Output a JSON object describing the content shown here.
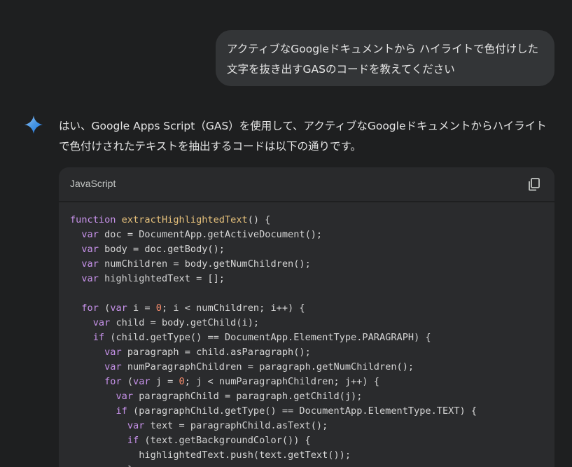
{
  "user_message": {
    "text": "アクティブなGoogleドキュメントから ハイライトで色付けした文字を抜き出すGASのコードを教えてください"
  },
  "assistant": {
    "icon": "gemini-sparkle-icon",
    "response_text": "はい、Google Apps Script（GAS）を使用して、アクティブなGoogleドキュメントからハイライトで色付けされたテキストを抽出するコードは以下の通りです。",
    "code_block": {
      "language": "JavaScript",
      "copy_icon": "copy-icon",
      "lines": [
        [
          {
            "t": "kw",
            "v": "function"
          },
          {
            "t": "",
            "v": " "
          },
          {
            "t": "fn",
            "v": "extractHighlightedText"
          },
          {
            "t": "",
            "v": "() {"
          }
        ],
        [
          {
            "t": "",
            "v": "  "
          },
          {
            "t": "kw",
            "v": "var"
          },
          {
            "t": "",
            "v": " doc = DocumentApp.getActiveDocument();"
          }
        ],
        [
          {
            "t": "",
            "v": "  "
          },
          {
            "t": "kw",
            "v": "var"
          },
          {
            "t": "",
            "v": " body = doc.getBody();"
          }
        ],
        [
          {
            "t": "",
            "v": "  "
          },
          {
            "t": "kw",
            "v": "var"
          },
          {
            "t": "",
            "v": " numChildren = body.getNumChildren();"
          }
        ],
        [
          {
            "t": "",
            "v": "  "
          },
          {
            "t": "kw",
            "v": "var"
          },
          {
            "t": "",
            "v": " highlightedText = [];"
          }
        ],
        [
          {
            "t": "",
            "v": ""
          }
        ],
        [
          {
            "t": "",
            "v": "  "
          },
          {
            "t": "kw",
            "v": "for"
          },
          {
            "t": "",
            "v": " ("
          },
          {
            "t": "kw",
            "v": "var"
          },
          {
            "t": "",
            "v": " i = "
          },
          {
            "t": "num",
            "v": "0"
          },
          {
            "t": "",
            "v": "; i < numChildren; i++) {"
          }
        ],
        [
          {
            "t": "",
            "v": "    "
          },
          {
            "t": "kw",
            "v": "var"
          },
          {
            "t": "",
            "v": " child = body.getChild(i);"
          }
        ],
        [
          {
            "t": "",
            "v": "    "
          },
          {
            "t": "kw",
            "v": "if"
          },
          {
            "t": "",
            "v": " (child.getType() == DocumentApp.ElementType.PARAGRAPH) {"
          }
        ],
        [
          {
            "t": "",
            "v": "      "
          },
          {
            "t": "kw",
            "v": "var"
          },
          {
            "t": "",
            "v": " paragraph = child.asParagraph();"
          }
        ],
        [
          {
            "t": "",
            "v": "      "
          },
          {
            "t": "kw",
            "v": "var"
          },
          {
            "t": "",
            "v": " numParagraphChildren = paragraph.getNumChildren();"
          }
        ],
        [
          {
            "t": "",
            "v": "      "
          },
          {
            "t": "kw",
            "v": "for"
          },
          {
            "t": "",
            "v": " ("
          },
          {
            "t": "kw",
            "v": "var"
          },
          {
            "t": "",
            "v": " j = "
          },
          {
            "t": "num",
            "v": "0"
          },
          {
            "t": "",
            "v": "; j < numParagraphChildren; j++) {"
          }
        ],
        [
          {
            "t": "",
            "v": "        "
          },
          {
            "t": "kw",
            "v": "var"
          },
          {
            "t": "",
            "v": " paragraphChild = paragraph.getChild(j);"
          }
        ],
        [
          {
            "t": "",
            "v": "        "
          },
          {
            "t": "kw",
            "v": "if"
          },
          {
            "t": "",
            "v": " (paragraphChild.getType() == DocumentApp.ElementType.TEXT) {"
          }
        ],
        [
          {
            "t": "",
            "v": "          "
          },
          {
            "t": "kw",
            "v": "var"
          },
          {
            "t": "",
            "v": " text = paragraphChild.asText();"
          }
        ],
        [
          {
            "t": "",
            "v": "          "
          },
          {
            "t": "kw",
            "v": "if"
          },
          {
            "t": "",
            "v": " (text.getBackgroundColor()) {"
          }
        ],
        [
          {
            "t": "",
            "v": "            highlightedText.push(text.getText());"
          }
        ],
        [
          {
            "t": "",
            "v": "          }"
          }
        ]
      ]
    }
  },
  "colors": {
    "background": "#1e1f20",
    "user_bubble": "#333537",
    "code_background": "#2a2b2d",
    "keyword": "#c792ea",
    "function_name": "#e5c07b",
    "number": "#f78c6c",
    "gemini_gradient_start": "#4796e3",
    "gemini_gradient_end": "#1a73e8"
  }
}
